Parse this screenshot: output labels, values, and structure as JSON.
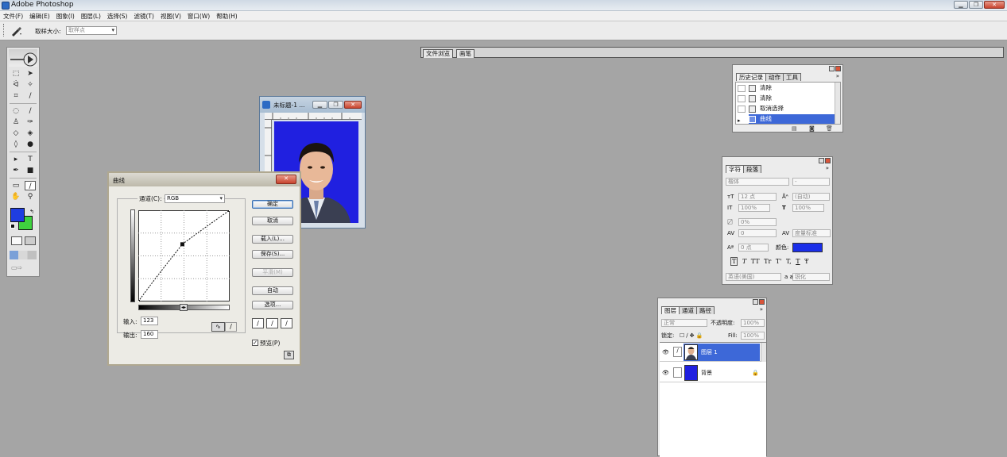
{
  "app": {
    "title": "Adobe Photoshop"
  },
  "window_buttons": {
    "minimize": "▁",
    "restore": "❐",
    "close": "✕"
  },
  "menu": [
    "文件(F)",
    "编辑(E)",
    "图象(I)",
    "图层(L)",
    "选择(S)",
    "滤镜(T)",
    "视图(V)",
    "窗口(W)",
    "帮助(H)"
  ],
  "options": {
    "sample_label": "取样大小:",
    "sample_value": "取样点"
  },
  "well_tabs": [
    "文件浏览",
    "画笔"
  ],
  "document": {
    "title": "未标题-1 ..."
  },
  "curves": {
    "title": "曲线",
    "channel_label": "通道(C):",
    "channel_value": "RGB",
    "buttons": {
      "ok": "确定",
      "cancel": "取消",
      "load": "载入(L)...",
      "save": "保存(S)...",
      "smooth": "平滑(M)",
      "auto": "自动",
      "options": "选项..."
    },
    "input_label": "输入:",
    "input_value": "123",
    "output_label": "输出:",
    "output_value": "160",
    "preview_label": "预览(P)",
    "preview_checked": true,
    "curve_points": [
      [
        0,
        0
      ],
      [
        123,
        160
      ],
      [
        255,
        255
      ]
    ]
  },
  "history": {
    "tabs": [
      "历史记录",
      "动作",
      "工具"
    ],
    "items": [
      "清除",
      "清除",
      "取消选择",
      "曲线"
    ],
    "selected_index": 3
  },
  "character": {
    "tabs": [
      "字符",
      "段落"
    ],
    "font": "楷体",
    "style": "-",
    "size": "12 点",
    "leading": "(自动)",
    "vscale": "100%",
    "hscale": "100%",
    "scale_pct": "0%",
    "tracking": "0",
    "kerning": "度量标准",
    "baseline": "0 点",
    "color_label": "颜色:",
    "color": "#1a2ee8",
    "style_buttons": [
      "T",
      "T",
      "TT",
      "Tr",
      "T'",
      "T,",
      "T",
      "Ŧ"
    ],
    "language": "英语(美国)",
    "aa_label": "a a",
    "aa_value": "锐化"
  },
  "layers": {
    "tabs": [
      "图层",
      "通道",
      "路径"
    ],
    "blend_mode": "正常",
    "opacity_label": "不透明度:",
    "opacity": "100%",
    "lock_label": "锁定:",
    "fill_label": "Fill:",
    "fill": "100%",
    "items": [
      {
        "name": "图层 1",
        "selected": true
      },
      {
        "name": "背景",
        "selected": false,
        "locked": true
      }
    ]
  },
  "colors": {
    "foreground": "#1f3de0",
    "background": "#3fd23f",
    "photo_bg": "#2020e0",
    "selection": "#3d68d8"
  }
}
